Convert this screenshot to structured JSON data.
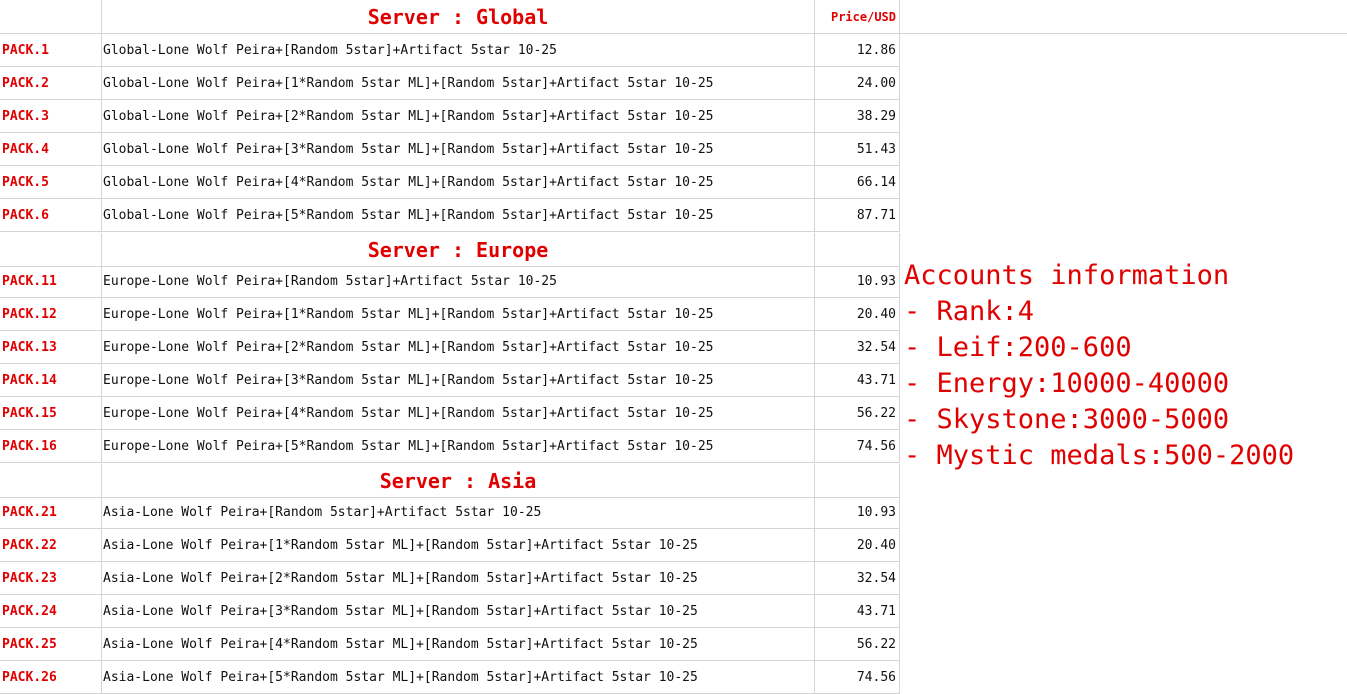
{
  "price_header": "Price/USD",
  "sections": [
    {
      "title": "Server : Global",
      "packs": [
        {
          "label": "PACK.1",
          "desc": "Global-Lone Wolf Peira+[Random 5star]+Artifact 5star 10-25",
          "price": "12.86"
        },
        {
          "label": "PACK.2",
          "desc": "Global-Lone Wolf Peira+[1*Random 5star ML]+[Random 5star]+Artifact 5star 10-25",
          "price": "24.00"
        },
        {
          "label": "PACK.3",
          "desc": "Global-Lone Wolf Peira+[2*Random 5star ML]+[Random 5star]+Artifact 5star 10-25",
          "price": "38.29"
        },
        {
          "label": "PACK.4",
          "desc": "Global-Lone Wolf Peira+[3*Random 5star ML]+[Random 5star]+Artifact 5star 10-25",
          "price": "51.43"
        },
        {
          "label": "PACK.5",
          "desc": "Global-Lone Wolf Peira+[4*Random 5star ML]+[Random 5star]+Artifact 5star 10-25",
          "price": "66.14"
        },
        {
          "label": "PACK.6",
          "desc": "Global-Lone Wolf Peira+[5*Random 5star ML]+[Random 5star]+Artifact 5star 10-25",
          "price": "87.71"
        }
      ]
    },
    {
      "title": "Server : Europe",
      "packs": [
        {
          "label": "PACK.11",
          "desc": "Europe-Lone Wolf Peira+[Random 5star]+Artifact 5star 10-25",
          "price": "10.93"
        },
        {
          "label": "PACK.12",
          "desc": "Europe-Lone Wolf Peira+[1*Random 5star ML]+[Random 5star]+Artifact 5star 10-25",
          "price": "20.40"
        },
        {
          "label": "PACK.13",
          "desc": "Europe-Lone Wolf Peira+[2*Random 5star ML]+[Random 5star]+Artifact 5star 10-25",
          "price": "32.54"
        },
        {
          "label": "PACK.14",
          "desc": "Europe-Lone Wolf Peira+[3*Random 5star ML]+[Random 5star]+Artifact 5star 10-25",
          "price": "43.71"
        },
        {
          "label": "PACK.15",
          "desc": "Europe-Lone Wolf Peira+[4*Random 5star ML]+[Random 5star]+Artifact 5star 10-25",
          "price": "56.22"
        },
        {
          "label": "PACK.16",
          "desc": "Europe-Lone Wolf Peira+[5*Random 5star ML]+[Random 5star]+Artifact 5star 10-25",
          "price": "74.56"
        }
      ]
    },
    {
      "title": "Server : Asia",
      "packs": [
        {
          "label": "PACK.21",
          "desc": "Asia-Lone Wolf Peira+[Random 5star]+Artifact 5star 10-25",
          "price": "10.93"
        },
        {
          "label": "PACK.22",
          "desc": "Asia-Lone Wolf Peira+[1*Random 5star ML]+[Random 5star]+Artifact 5star 10-25",
          "price": "20.40"
        },
        {
          "label": "PACK.23",
          "desc": "Asia-Lone Wolf Peira+[2*Random 5star ML]+[Random 5star]+Artifact 5star 10-25",
          "price": "32.54"
        },
        {
          "label": "PACK.24",
          "desc": "Asia-Lone Wolf Peira+[3*Random 5star ML]+[Random 5star]+Artifact 5star 10-25",
          "price": "43.71"
        },
        {
          "label": "PACK.25",
          "desc": "Asia-Lone Wolf Peira+[4*Random 5star ML]+[Random 5star]+Artifact 5star 10-25",
          "price": "56.22"
        },
        {
          "label": "PACK.26",
          "desc": "Asia-Lone Wolf Peira+[5*Random 5star ML]+[Random 5star]+Artifact 5star 10-25",
          "price": "74.56"
        }
      ]
    }
  ],
  "accounts_info": {
    "title": "Accounts information",
    "lines": [
      "- Rank:4",
      "- Leif:200-600",
      "- Energy:10000-40000",
      "- Skystone:3000-5000",
      "- Mystic medals:500-2000"
    ]
  },
  "colors": {
    "accent_red": "#e00000",
    "text": "#111111",
    "grid": "#d4d4d4"
  }
}
